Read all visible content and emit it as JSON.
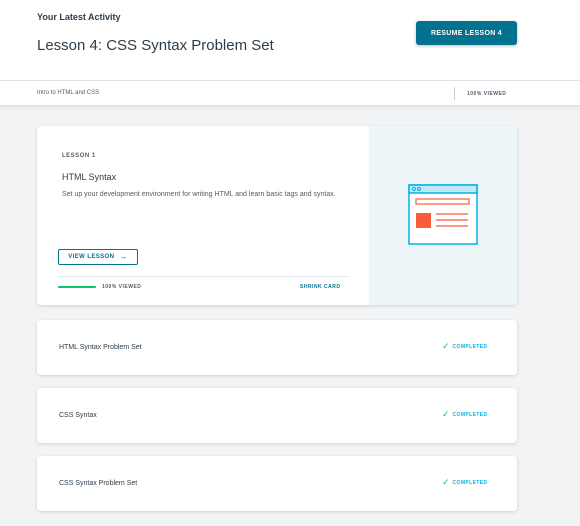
{
  "header": {
    "activity_label": "Your Latest Activity",
    "lesson_title": "Lesson 4: CSS Syntax Problem Set",
    "resume_button": "RESUME LESSON 4"
  },
  "subbar": {
    "course_name": "Intro to HTML and CSS",
    "viewed": "100% VIEWED"
  },
  "expanded_lesson": {
    "number_label": "LESSON 1",
    "title": "HTML Syntax",
    "description": "Set up your development environment for writing HTML and learn basic tags and syntax.",
    "view_button": "VIEW LESSON",
    "view_button_arrow": "→",
    "progress_fraction": 1.0,
    "viewed": "100% VIEWED",
    "shrink_link": "SHRINK CARD",
    "illustration_icon": "browser-window-icon"
  },
  "lessons": [
    {
      "title": "HTML Syntax Problem Set",
      "status": "COMPLETED",
      "status_icon": "check-icon"
    },
    {
      "title": "CSS Syntax",
      "status": "COMPLETED",
      "status_icon": "check-icon"
    },
    {
      "title": "CSS Syntax Problem Set",
      "status": "COMPLETED",
      "status_icon": "check-icon"
    }
  ],
  "colors": {
    "accent": "#02728f",
    "progress": "#15c26b",
    "completed": "#02b3e4",
    "illustration_stroke": "#02b3e4",
    "illustration_fill": "#f95c3c",
    "page_background": "#f2f3f4"
  }
}
